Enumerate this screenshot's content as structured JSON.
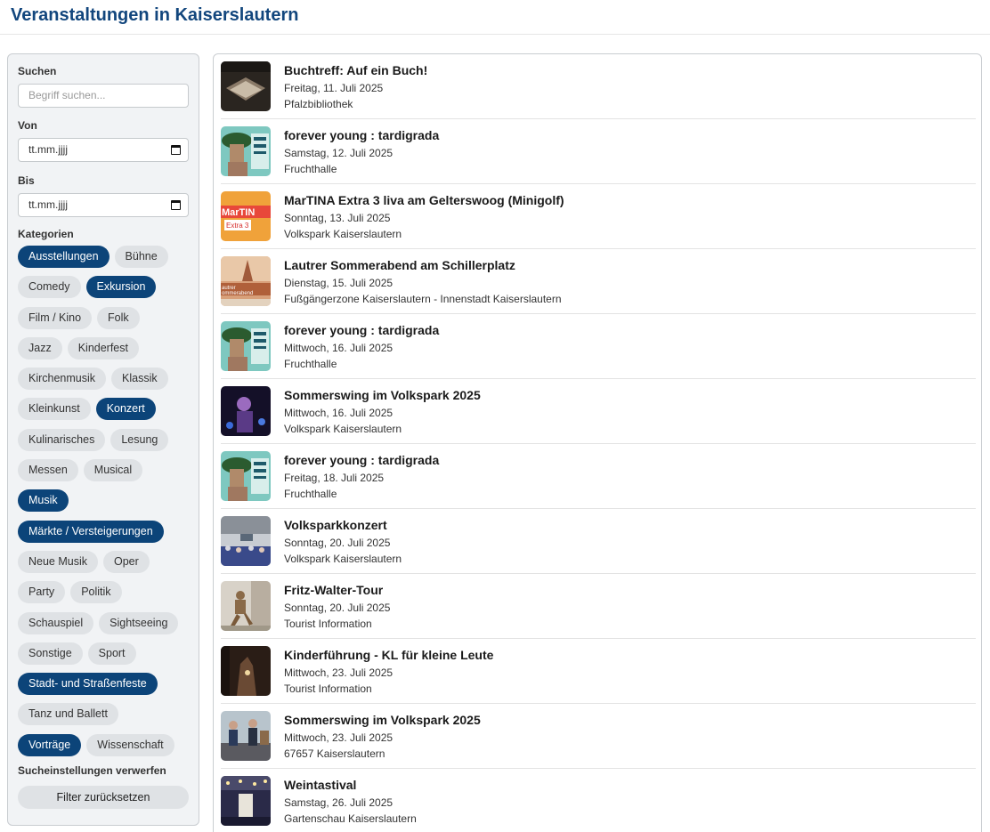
{
  "header": {
    "title": "Veranstaltungen in Kaiserslautern"
  },
  "sidebar": {
    "search_label": "Suchen",
    "search_placeholder": "Begriff suchen...",
    "from_label": "Von",
    "from_value": "tt.mm.jjjj",
    "to_label": "Bis",
    "to_value": "tt.mm.jjjj",
    "categories_label": "Kategorien",
    "categories": [
      {
        "label": "Ausstellungen",
        "active": true
      },
      {
        "label": "Bühne",
        "active": false
      },
      {
        "label": "Comedy",
        "active": false
      },
      {
        "label": "Exkursion",
        "active": true
      },
      {
        "label": "Film / Kino",
        "active": false
      },
      {
        "label": "Folk",
        "active": false
      },
      {
        "label": "Jazz",
        "active": false
      },
      {
        "label": "Kinderfest",
        "active": false
      },
      {
        "label": "Kirchenmusik",
        "active": false
      },
      {
        "label": "Klassik",
        "active": false
      },
      {
        "label": "Kleinkunst",
        "active": false
      },
      {
        "label": "Konzert",
        "active": true
      },
      {
        "label": "Kulinarisches",
        "active": false
      },
      {
        "label": "Lesung",
        "active": false
      },
      {
        "label": "Messen",
        "active": false
      },
      {
        "label": "Musical",
        "active": false
      },
      {
        "label": "Musik",
        "active": true
      },
      {
        "label": "Märkte / Versteigerungen",
        "active": true
      },
      {
        "label": "Neue Musik",
        "active": false
      },
      {
        "label": "Oper",
        "active": false
      },
      {
        "label": "Party",
        "active": false
      },
      {
        "label": "Politik",
        "active": false
      },
      {
        "label": "Schauspiel",
        "active": false
      },
      {
        "label": "Sightseeing",
        "active": false
      },
      {
        "label": "Sonstige",
        "active": false
      },
      {
        "label": "Sport",
        "active": false
      },
      {
        "label": "Stadt- und Straßenfeste",
        "active": true
      },
      {
        "label": "Tanz und Ballett",
        "active": false
      },
      {
        "label": "Vorträge",
        "active": true
      },
      {
        "label": "Wissenschaft",
        "active": false
      }
    ],
    "reset_title": "Sucheinstellungen verwerfen",
    "reset_button": "Filter zurücksetzen"
  },
  "events": [
    {
      "title": "Buchtreff: Auf ein Buch!",
      "date": "Freitag, 11. Juli 2025",
      "place": "Pfalzbibliothek",
      "thumb": "book"
    },
    {
      "title": "forever young : tardigrada",
      "date": "Samstag, 12. Juli 2025",
      "place": "Fruchthalle",
      "thumb": "forever"
    },
    {
      "title": "MarTINA Extra 3 liva am Gelterswoog (Minigolf)",
      "date": "Sonntag, 13. Juli 2025",
      "place": "Volkspark Kaiserslautern",
      "thumb": "martina",
      "thumb_text": "MarTIN",
      "thumb_sub": "Extra 3"
    },
    {
      "title": "Lautrer Sommerabend am Schillerplatz",
      "date": "Dienstag, 15. Juli 2025",
      "place": "Fußgängerzone Kaiserslautern - Innenstadt Kaiserslautern",
      "thumb": "sommerabend",
      "thumb_text": "autrer",
      "thumb_sub": "ommerabend"
    },
    {
      "title": "forever young : tardigrada",
      "date": "Mittwoch, 16. Juli 2025",
      "place": "Fruchthalle",
      "thumb": "forever"
    },
    {
      "title": "Sommerswing im Volkspark 2025",
      "date": "Mittwoch, 16. Juli 2025",
      "place": "Volkspark Kaiserslautern",
      "thumb": "singer"
    },
    {
      "title": "forever young : tardigrada",
      "date": "Freitag, 18. Juli 2025",
      "place": "Fruchthalle",
      "thumb": "forever"
    },
    {
      "title": "Volksparkkonzert",
      "date": "Sonntag, 20. Juli 2025",
      "place": "Volkspark Kaiserslautern",
      "thumb": "crowd"
    },
    {
      "title": "Fritz-Walter-Tour",
      "date": "Sonntag, 20. Juli 2025",
      "place": "Tourist Information",
      "thumb": "statue"
    },
    {
      "title": "Kinderführung - KL für kleine Leute",
      "date": "Mittwoch, 23. Juli 2025",
      "place": "Tourist Information",
      "thumb": "cave"
    },
    {
      "title": "Sommerswing im Volkspark 2025",
      "date": "Mittwoch, 23. Juli 2025",
      "place": "67657 Kaiserslautern",
      "thumb": "band"
    },
    {
      "title": "Weintastival",
      "date": "Samstag, 26. Juli 2025",
      "place": "Gartenschau Kaiserslautern",
      "thumb": "wine"
    }
  ],
  "colors": {
    "brand": "#12467d",
    "chip_active": "#0c4479",
    "chip_inactive": "#dfe2e5"
  }
}
